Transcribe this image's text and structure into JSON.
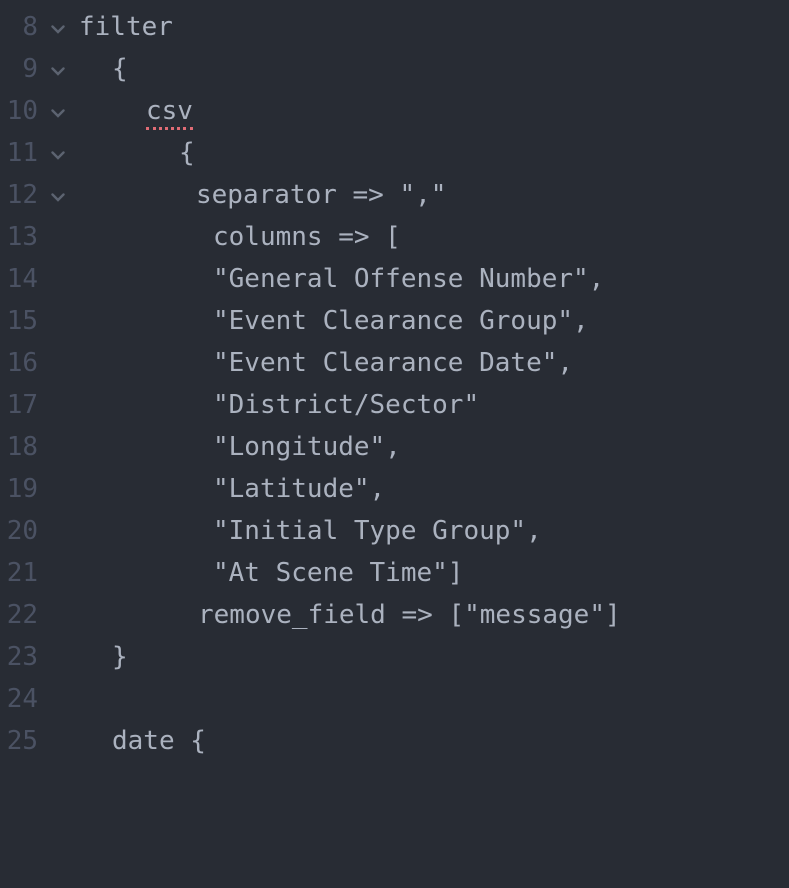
{
  "editor": {
    "lines": [
      {
        "number": "8",
        "foldable": true,
        "text": "filter"
      },
      {
        "number": "9",
        "foldable": true,
        "text": "{"
      },
      {
        "number": "10",
        "foldable": true,
        "text": "csv",
        "squiggle": true
      },
      {
        "number": "11",
        "foldable": true,
        "text": "{"
      },
      {
        "number": "12",
        "foldable": true,
        "text": "separator => \",\""
      },
      {
        "number": "13",
        "foldable": false,
        "text": "columns => ["
      },
      {
        "number": "14",
        "foldable": false,
        "text": "\"General Offense Number\","
      },
      {
        "number": "15",
        "foldable": false,
        "text": "\"Event Clearance Group\","
      },
      {
        "number": "16",
        "foldable": false,
        "text": "\"Event Clearance Date\","
      },
      {
        "number": "17",
        "foldable": false,
        "text": "\"District/Sector\""
      },
      {
        "number": "18",
        "foldable": false,
        "text": "\"Longitude\","
      },
      {
        "number": "19",
        "foldable": false,
        "text": "\"Latitude\","
      },
      {
        "number": "20",
        "foldable": false,
        "text": "\"Initial Type Group\","
      },
      {
        "number": "21",
        "foldable": false,
        "text": "\"At Scene Time\"]"
      },
      {
        "number": "22",
        "foldable": false,
        "text": "remove_field => [\"message\"]"
      },
      {
        "number": "23",
        "foldable": false,
        "text": "}"
      },
      {
        "number": "24",
        "foldable": false,
        "text": ""
      },
      {
        "number": "25",
        "foldable": false,
        "text": "date {"
      }
    ],
    "colors": {
      "background": "#282c34",
      "text": "#abb2bf",
      "gutter": "#4b5263",
      "fold_icon": "#5c6370",
      "spell_error": "#e06c75"
    },
    "icons": {
      "fold": "chevron-down-icon"
    }
  }
}
